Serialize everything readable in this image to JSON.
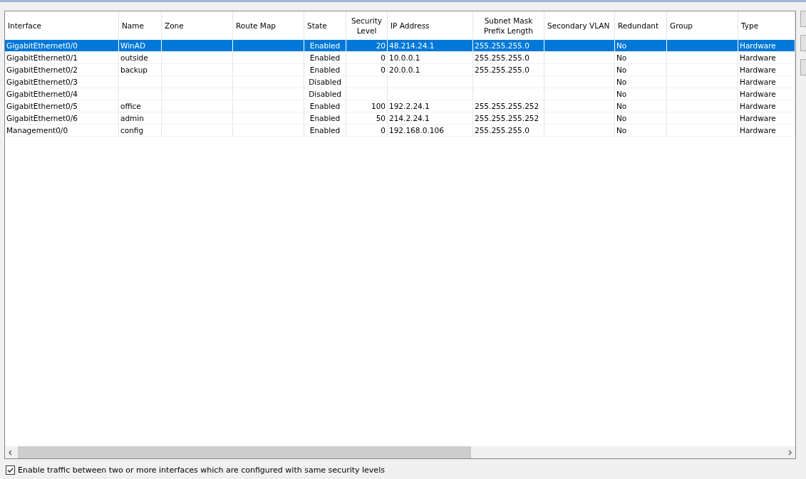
{
  "table": {
    "columns": [
      "Interface",
      "Name",
      "Zone",
      "Route Map",
      "State",
      "Security Level",
      "IP Address",
      "Subnet Mask Prefix Length",
      "Secondary VLAN",
      "Redundant",
      "Group",
      "Type"
    ],
    "rows": [
      {
        "selected": true,
        "cells": [
          "GigabitEthernet0/0",
          "WinAD",
          "",
          "",
          "Enabled",
          "20",
          "48.214.24.1",
          "255.255.255.0",
          "",
          "No",
          "",
          "Hardware"
        ]
      },
      {
        "selected": false,
        "cells": [
          "GigabitEthernet0/1",
          "outside",
          "",
          "",
          "Enabled",
          "0",
          "10.0.0.1",
          "255.255.255.0",
          "",
          "No",
          "",
          "Hardware"
        ]
      },
      {
        "selected": false,
        "cells": [
          "GigabitEthernet0/2",
          "backup",
          "",
          "",
          "Enabled",
          "0",
          "20.0.0.1",
          "255.255.255.0",
          "",
          "No",
          "",
          "Hardware"
        ]
      },
      {
        "selected": false,
        "cells": [
          "GigabitEthernet0/3",
          "",
          "",
          "",
          "Disabled",
          "",
          "",
          "",
          "",
          "No",
          "",
          "Hardware"
        ]
      },
      {
        "selected": false,
        "cells": [
          "GigabitEthernet0/4",
          "",
          "",
          "",
          "Disabled",
          "",
          "",
          "",
          "",
          "No",
          "",
          "Hardware"
        ]
      },
      {
        "selected": false,
        "cells": [
          "GigabitEthernet0/5",
          "office",
          "",
          "",
          "Enabled",
          "100",
          "192.2.24.1",
          "255.255.255.252",
          "",
          "No",
          "",
          "Hardware"
        ]
      },
      {
        "selected": false,
        "cells": [
          "GigabitEthernet0/6",
          "admin",
          "",
          "",
          "Enabled",
          "50",
          "214.2.24.1",
          "255.255.255.252",
          "",
          "No",
          "",
          "Hardware"
        ]
      },
      {
        "selected": false,
        "cells": [
          "Management0/0",
          "config",
          "",
          "",
          "Enabled",
          "0",
          "192.168.0.106",
          "255.255.255.0",
          "",
          "No",
          "",
          "Hardware"
        ]
      }
    ]
  },
  "option": {
    "label": "Enable traffic between two or more interfaces which are configured with same security levels",
    "checked": true
  }
}
